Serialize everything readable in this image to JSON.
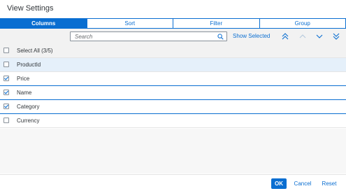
{
  "dialog": {
    "title": "View Settings"
  },
  "tabs": [
    {
      "label": "Columns",
      "active": true
    },
    {
      "label": "Sort",
      "active": false
    },
    {
      "label": "Filter",
      "active": false
    },
    {
      "label": "Group",
      "active": false
    }
  ],
  "toolbar": {
    "search_placeholder": "Search",
    "search_value": "",
    "show_selected": "Show Selected",
    "icons": [
      "search-icon",
      "move-to-top-icon",
      "move-up-icon",
      "move-down-icon",
      "move-to-bottom-icon"
    ]
  },
  "select_all": {
    "label": "Select All (3/5)",
    "checked": false
  },
  "columns": [
    {
      "label": "ProductId",
      "checked": false
    },
    {
      "label": "Price",
      "checked": true
    },
    {
      "label": "Name",
      "checked": true
    },
    {
      "label": "Category",
      "checked": true
    },
    {
      "label": "Currency",
      "checked": false
    }
  ],
  "footer": {
    "ok": "OK",
    "cancel": "Cancel",
    "reset": "Reset"
  },
  "colors": {
    "accent": "#0a6ed1",
    "text": "#32363a",
    "hover_row": "#e5f0fa",
    "toolbar_bg": "#f2f2f2"
  }
}
